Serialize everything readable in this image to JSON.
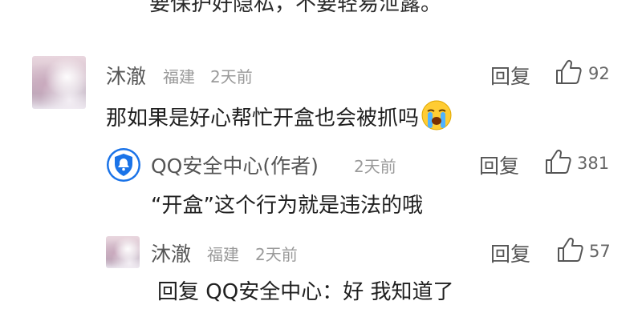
{
  "previous_comment": {
    "text_fragment": "要保护好隐私，不要轻易泄露。"
  },
  "comments": [
    {
      "author": "沐澈",
      "location": "福建",
      "time": "2天前",
      "reply_label": "回复",
      "likes": "92",
      "text": "那如果是好心帮忙开盒也会被抓吗",
      "emoji": "😭",
      "replies": [
        {
          "author": "QQ安全中心(作者)",
          "time": "2天前",
          "reply_label": "回复",
          "likes": "381",
          "text": "“开盒”这个行为就是违法的哦"
        },
        {
          "author": "沐澈",
          "location": "福建",
          "time": "2天前",
          "reply_label": "回复",
          "likes": "57",
          "text": "回复 QQ安全中心：好 我知道了"
        }
      ]
    }
  ],
  "colors": {
    "qq_security_blue": "#1a73e8",
    "name_gray": "#555555",
    "meta_gray": "#9a9a9a"
  },
  "icons": [
    "thumbs-up-icon",
    "qq-security-shield-icon",
    "loudly-crying-emoji"
  ]
}
